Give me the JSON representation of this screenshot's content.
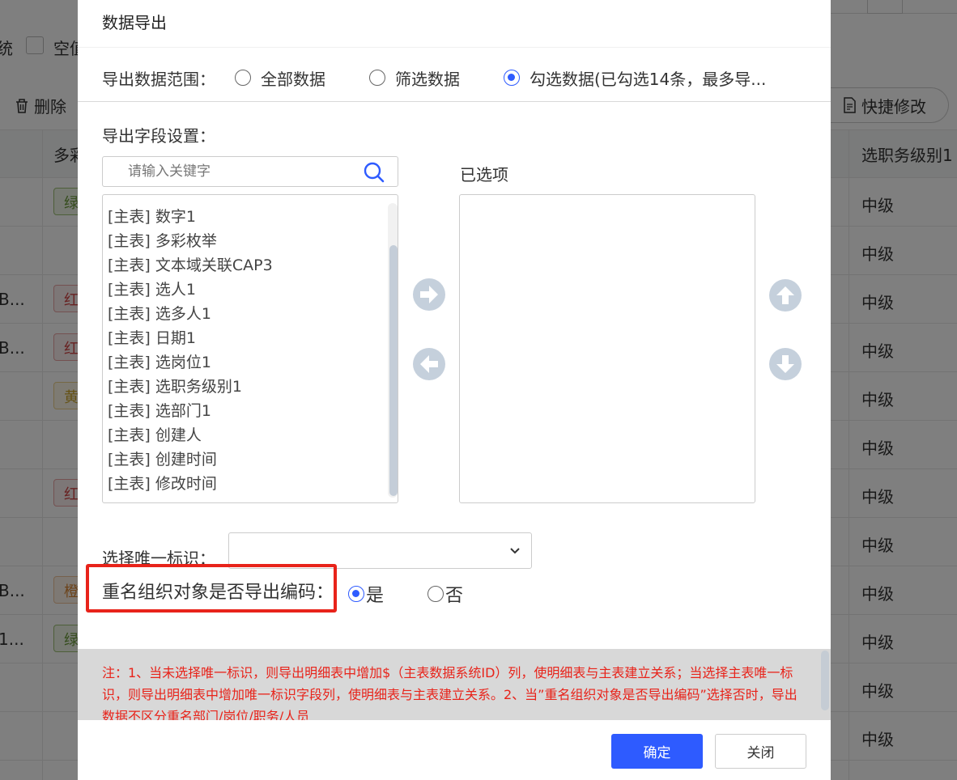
{
  "background": {
    "left_label": "统",
    "checkbox_label": "空值",
    "delete_button": "删除",
    "quick_edit_button": "快捷修改",
    "header_left": "多彩",
    "header_right": "选职务级别1",
    "rows": [
      {
        "c0": "",
        "tag": "绿",
        "c2": "中级"
      },
      {
        "c0": "",
        "tag": "",
        "c2": "中级"
      },
      {
        "c0": "B...",
        "tag": "红",
        "c2": "中级"
      },
      {
        "c0": "B...",
        "tag": "红",
        "c2": "中级"
      },
      {
        "c0": "",
        "tag": "黄",
        "c2": "中级"
      },
      {
        "c0": "",
        "tag": "",
        "c2": "中级"
      },
      {
        "c0": "",
        "tag": "红",
        "c2": "中级"
      },
      {
        "c0": "",
        "tag": "",
        "c2": "中级"
      },
      {
        "c0": "B...",
        "tag": "橙",
        "c2": "中级"
      },
      {
        "c0": "1...",
        "tag": "绿",
        "c2": "中级"
      },
      {
        "c0": "",
        "tag": "",
        "c2": "中级"
      },
      {
        "c0": "",
        "tag": "",
        "c2": "中级"
      }
    ]
  },
  "dialog": {
    "title": "数据导出",
    "range": {
      "label": "导出数据范围：",
      "options": [
        {
          "label": "全部数据",
          "checked": false
        },
        {
          "label": "筛选数据",
          "checked": false
        },
        {
          "label": "勾选数据(已勾选14条，最多导...",
          "checked": true
        }
      ]
    },
    "fields_label": "导出字段设置：",
    "search_placeholder": "请输入关键字",
    "selected_label": "已选项",
    "fields": [
      "[主表] 数字1",
      "[主表] 多彩枚举",
      "[主表] 文本域关联CAP3",
      "[主表] 选人1",
      "[主表] 选多人1",
      "[主表] 日期1",
      "[主表] 选岗位1",
      "[主表] 选职务级别1",
      "[主表] 选部门1",
      "[主表] 创建人",
      "[主表] 创建时间",
      "[主表] 修改时间"
    ],
    "unique_label": "选择唯一标识：",
    "unique_value": "",
    "dup_label": "重名组织对象是否导出编码：",
    "dup_yes": "是",
    "dup_no": "否",
    "dup_selected": "yes",
    "note": "注：1、当未选择唯一标识，则导出明细表中增加$（主表数据系统ID）列，使明细表与主表建立关系；当选择主表唯一标识，则导出明细表中增加唯一标识字段列，使明细表与主表建立关系。2、当”重名组织对象是否导出编码”选择否时，导出数据不区分重名部门/岗位/职务/人员",
    "ok_button": "确定",
    "close_button": "关闭"
  },
  "colors": {
    "primary": "#2e5bff",
    "highlight_border": "#e8231a",
    "note_text": "#e8231a",
    "arrow_icon": "#c5d0dc"
  },
  "icons": {
    "search": "search-icon",
    "move_right": "arrow-right-circle-icon",
    "move_left": "arrow-left-circle-icon",
    "move_up": "arrow-up-circle-icon",
    "move_down": "arrow-down-circle-icon",
    "select_chevron": "chevron-down-icon",
    "delete": "trash-icon",
    "quick_edit": "edit-document-icon"
  }
}
